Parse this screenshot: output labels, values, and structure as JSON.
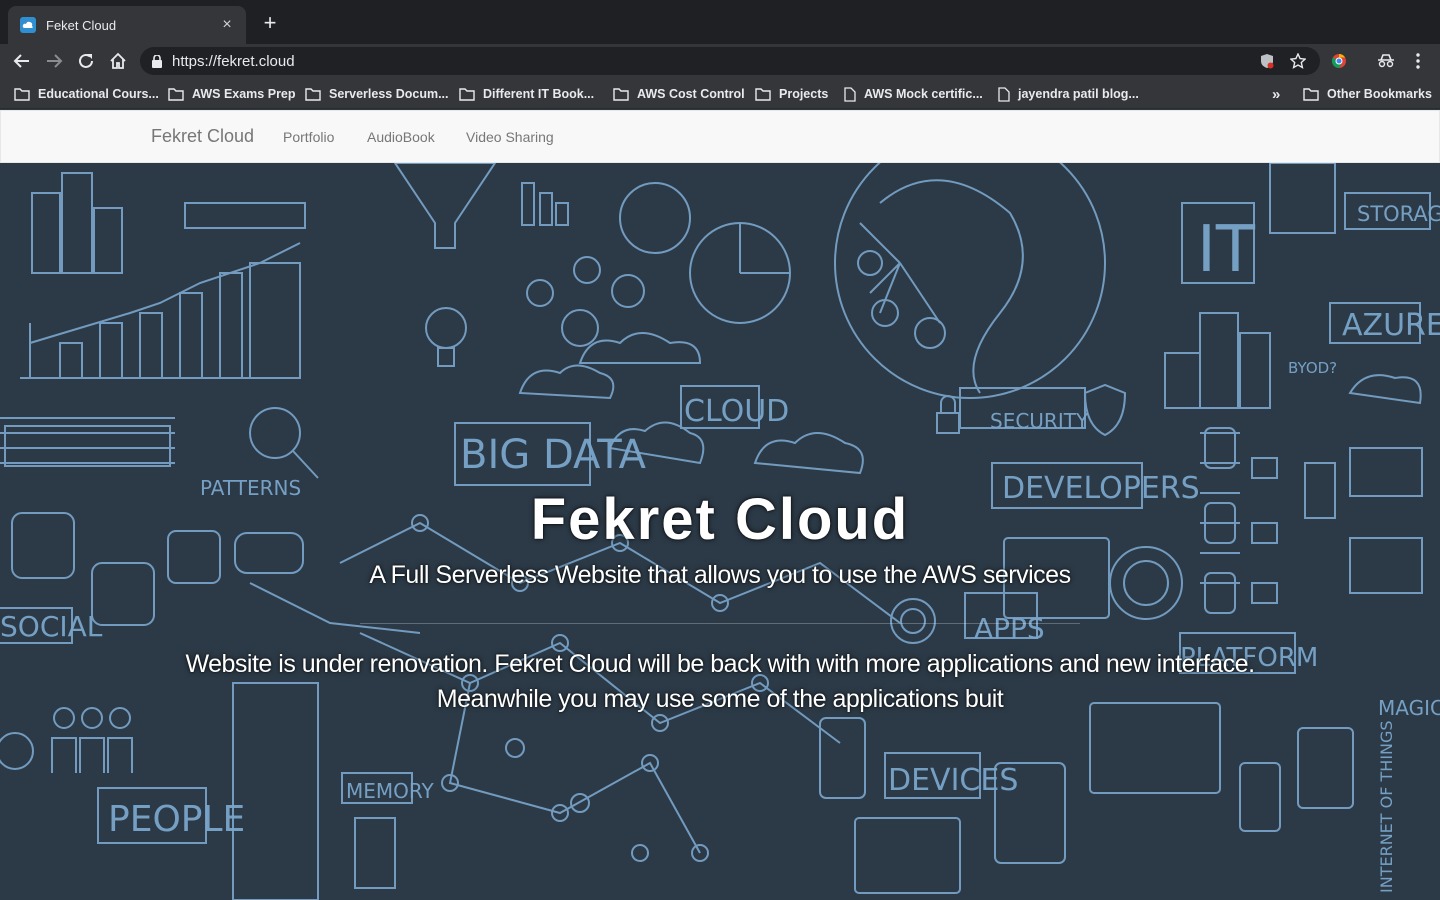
{
  "browser": {
    "tab": {
      "title": "Feket Cloud",
      "close_glyph": "×",
      "favicon_icon": "cloud-favicon-icon"
    },
    "new_tab_glyph": "+",
    "address": {
      "url": "https://fekret.cloud",
      "lock_icon": "lock-icon"
    },
    "bookmarks": [
      {
        "label": "Educational Cours...",
        "icon": "folder-icon"
      },
      {
        "label": "AWS Exams Prep",
        "icon": "folder-icon"
      },
      {
        "label": "Serverless Docum...",
        "icon": "folder-icon"
      },
      {
        "label": "Different IT Book...",
        "icon": "folder-icon"
      },
      {
        "label": "AWS Cost Control",
        "icon": "folder-icon"
      },
      {
        "label": "Projects",
        "icon": "folder-icon"
      },
      {
        "label": "AWS Mock certific...",
        "icon": "page-icon"
      },
      {
        "label": "jayendra patil blog...",
        "icon": "page-icon"
      }
    ],
    "overflow_glyph": "»",
    "other_bookmarks": "Other Bookmarks"
  },
  "site": {
    "brand": "Fekret Cloud",
    "nav": [
      "Portfolio",
      "AudioBook",
      "Video Sharing"
    ]
  },
  "hero": {
    "title": "Fekret Cloud",
    "subtitle": "A Full Serverless Website that allows you to use the AWS services",
    "message_line1": "Website is under renovation. Fekret Cloud will be back with with more applications and new interface.",
    "message_line2": "Meanwhile you may use some of the applications buit",
    "background_words": [
      "STORAGE",
      "IT",
      "AZURE",
      "BYOD?",
      "CLOUD",
      "BIG DATA",
      "SECURITY",
      "PATTERNS",
      "DEVELOPERS",
      "SOCIAL",
      "APPS",
      "PLATFORM",
      "MAGIC",
      "MEMORY",
      "PEOPLE",
      "DEVICES",
      "INTERNET OF THINGS"
    ]
  },
  "colors": {
    "chrome_dark": "#1f2023",
    "chrome_toolbar": "#35363a",
    "hero_bg": "#2c3a47",
    "doodle": "#7aa6cc",
    "nav_bg": "#f8f8f8"
  }
}
